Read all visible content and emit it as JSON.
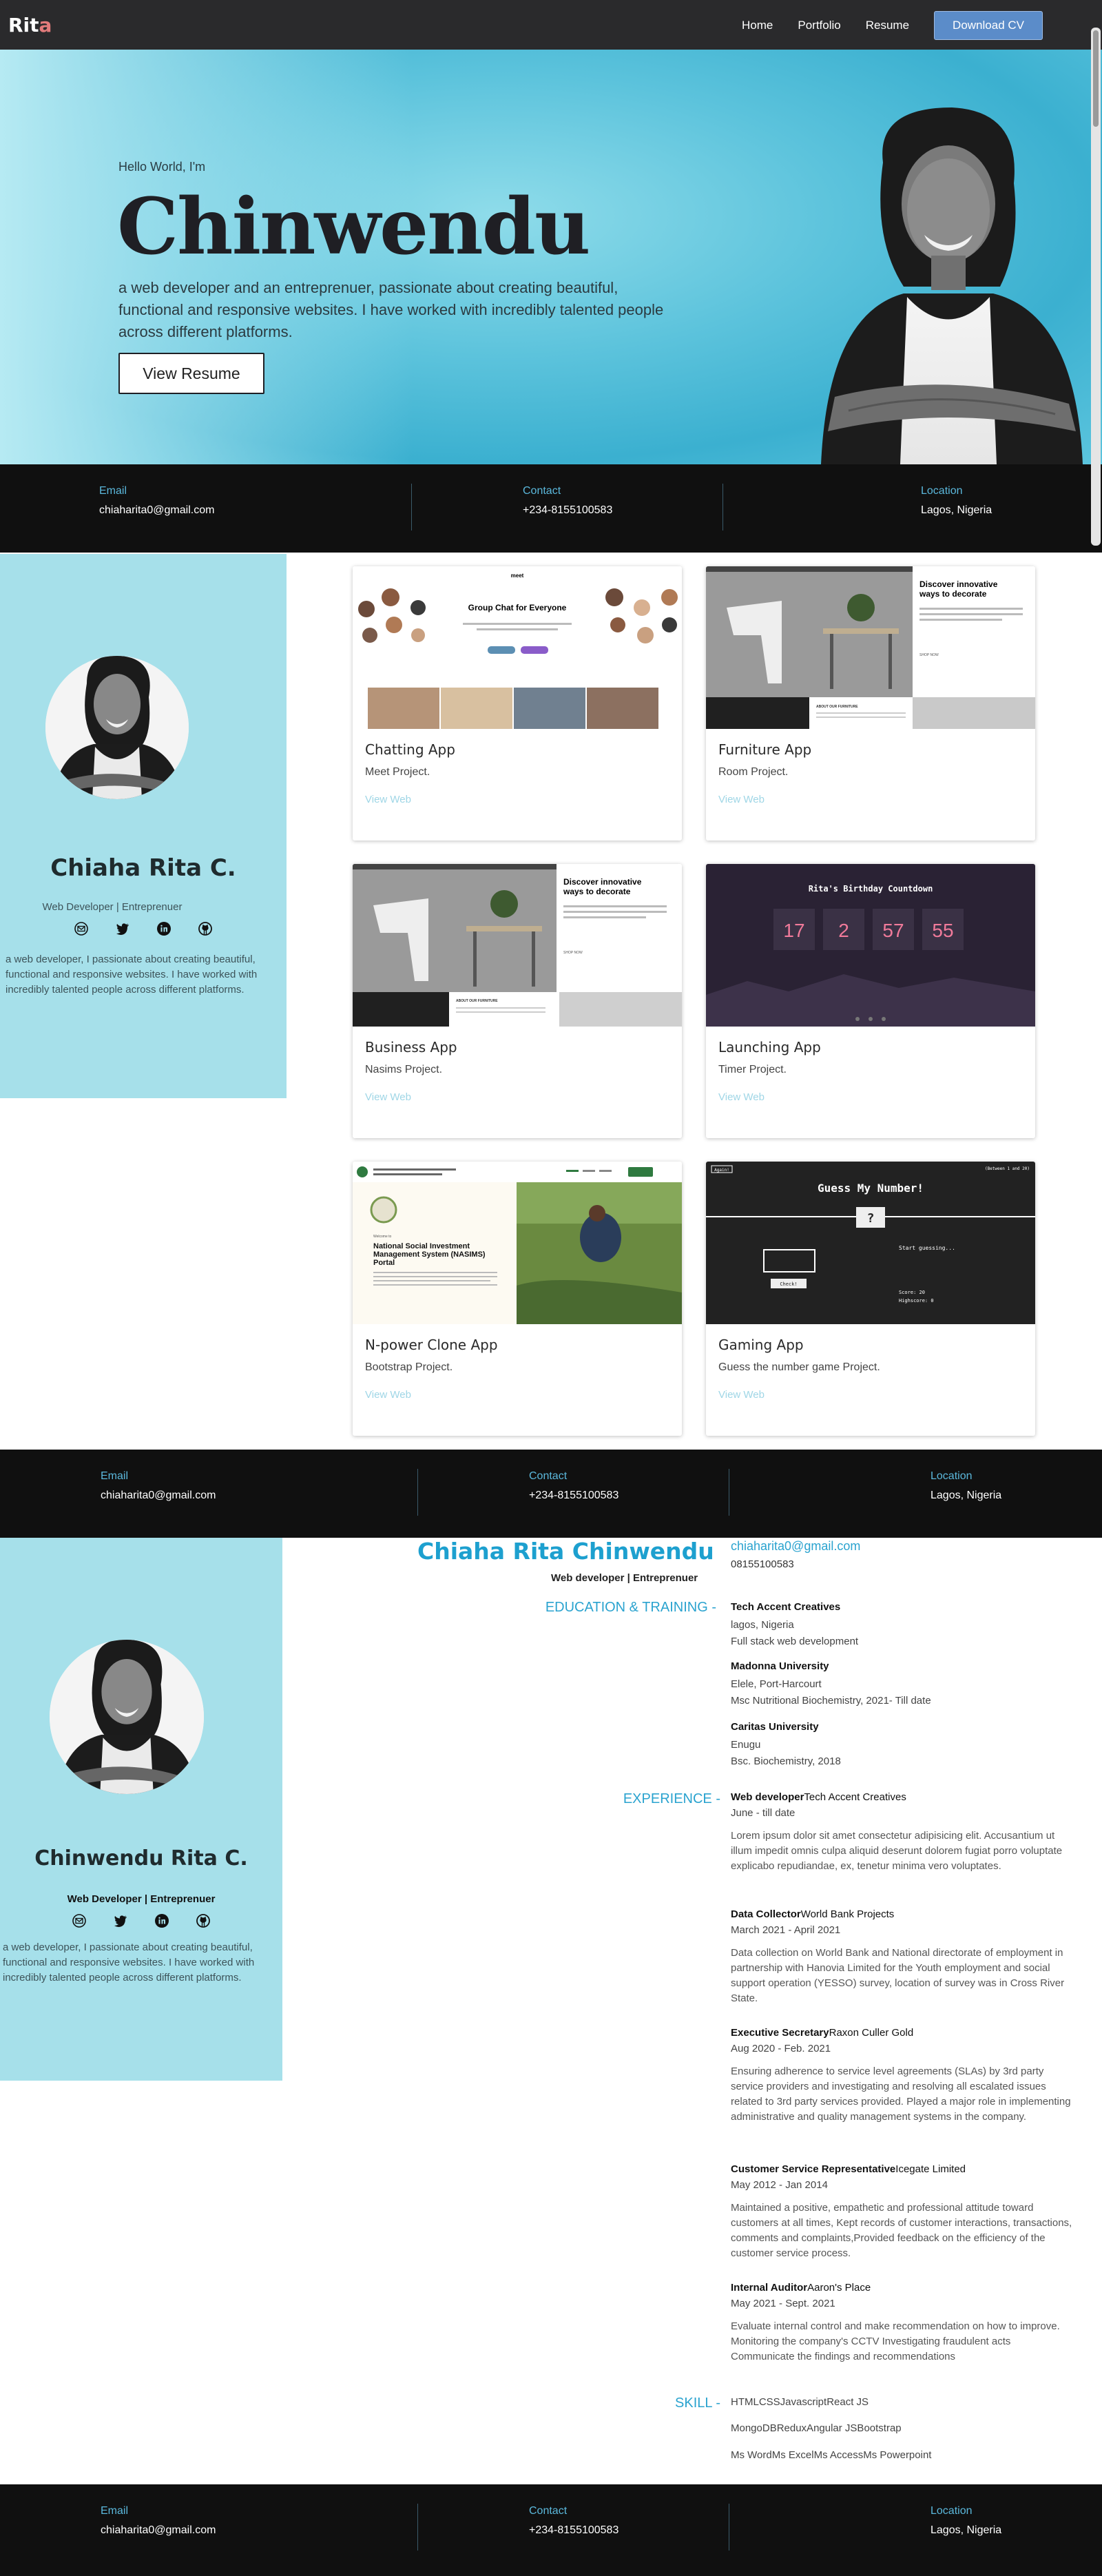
{
  "nav": {
    "logo_main": "Rit",
    "logo_accent": "a",
    "links": [
      "Home",
      "Portfolio",
      "Resume"
    ],
    "cta": "Download CV"
  },
  "hero": {
    "greeting": "Hello World, I'm",
    "name": "Chinwendu",
    "description": "a web developer and an entreprenuer, passionate about creating beautiful, functional and responsive websites. I have worked with incredibly talented people across different platforms.",
    "button": "View Resume"
  },
  "contact": {
    "email_label": "Email",
    "email": "chiaharita0@gmail.com",
    "contact_label": "Contact",
    "phone": "+234-8155100583",
    "location_label": "Location",
    "location": "Lagos, Nigeria"
  },
  "portfolio_profile": {
    "name": "Chiaha Rita C.",
    "role": "Web Developer | Entreprenuer",
    "description": "a web developer, I passionate about creating beautiful, functional and responsive websites. I have worked with incredibly talented people across different platforms."
  },
  "projects": [
    {
      "title": "Chatting App",
      "subtitle": "Meet Project.",
      "link": "View Web",
      "shot": {
        "brand": "meet",
        "headline": "Group Chat for Everyone"
      }
    },
    {
      "title": "Furniture App",
      "subtitle": "Room Project.",
      "link": "View Web",
      "shot": {
        "headline": "Discover innovative ways to decorate",
        "about": "ABOUT OUR FURNITURE",
        "shop": "SHOP NOW"
      }
    },
    {
      "title": "Business App",
      "subtitle": "Nasims Project.",
      "link": "View Web",
      "shot": {
        "headline": "Discover innovative ways to decorate",
        "about": "ABOUT OUR FURNITURE",
        "shop": "SHOP NOW"
      }
    },
    {
      "title": "Launching App",
      "subtitle": "Timer Project.",
      "link": "View Web",
      "shot": {
        "headline": "Rita's Birthday Countdown",
        "digits": [
          "17",
          "2",
          "57",
          "55"
        ]
      }
    },
    {
      "title": "N-power Clone App",
      "subtitle": "Bootstrap Project.",
      "link": "View Web",
      "shot": {
        "headline": "National Social Investment Management System (NASIMS) Portal",
        "label": "Welcome to"
      }
    },
    {
      "title": "Gaming App",
      "subtitle": "Guess the number game Project.",
      "link": "View Web",
      "shot": {
        "headline": "Guess My Number!",
        "again": "Again!",
        "range": "(Between 1 and 20)",
        "mark": "?",
        "start": "Start guessing...",
        "check": "Check!",
        "score": "Score: 20",
        "highscore": "Highscore: 0"
      }
    }
  ],
  "resume_profile": {
    "name": "Chinwendu Rita C.",
    "role": "Web Developer | Entreprenuer",
    "description": "a web developer, I passionate about creating beautiful, functional and responsive websites. I have worked with incredibly talented people across different platforms."
  },
  "resume": {
    "name": "Chiaha Rita Chinwendu",
    "role": "Web developer | Entreprenuer",
    "email": "chiaharita0@gmail.com",
    "phone": "08155100583",
    "education_heading": "EDUCATION & TRAINING -",
    "education": [
      {
        "org": "Tech Accent Creatives",
        "lines": [
          "lagos, Nigeria",
          "Full stack web development"
        ]
      },
      {
        "org": "Madonna University",
        "lines": [
          "Elele, Port-Harcourt",
          "Msc Nutritional Biochemistry, 2021- Till date"
        ]
      },
      {
        "org": "Caritas University",
        "lines": [
          "Enugu",
          "Bsc. Biochemistry, 2018"
        ]
      }
    ],
    "experience_heading": "EXPERIENCE -",
    "experience": [
      {
        "title": "Web developer",
        "company": "Tech Accent Creatives",
        "dates": "June - till date",
        "desc": "Lorem ipsum dolor sit amet consectetur adipisicing elit. Accusantium ut illum impedit omnis culpa aliquid deserunt dolorem fugiat porro voluptate explicabo repudiandae, ex, tenetur minima vero voluptates."
      },
      {
        "title": "Data Collector",
        "company": "World Bank Projects",
        "dates": "March 2021 - April 2021",
        "desc": "Data collection on World Bank and National directorate of employment in partnership with Hanovia Limited for the Youth employment and social support operation (YESSO) survey, location of survey was in Cross River State."
      },
      {
        "title": "Executive Secretary",
        "company": "Raxon Culler Gold",
        "dates": "Aug 2020 - Feb. 2021",
        "desc": "Ensuring adherence to service level agreements (SLAs) by 3rd party service providers and investigating and resolving all escalated issues related to 3rd party services provided. Played a major role in implementing administrative and quality management systems in the company."
      },
      {
        "title": "Customer Service Representative",
        "company": "Icegate Limited",
        "dates": "May 2012 - Jan 2014",
        "desc": "Maintained a positive, empathetic and professional attitude toward customers at all times, Kept records of customer interactions, transactions, comments and complaints,Provided feedback on the efficiency of the customer service process."
      },
      {
        "title": "Internal Auditor",
        "company": "Aaron's Place",
        "dates": "May 2021 - Sept. 2021",
        "desc": "Evaluate internal control and make recommendation on how to improve. Monitoring the company's CCTV Investigating fraudulent acts Communicate the findings and recommendations"
      }
    ],
    "skill_heading": "SKILL -",
    "skills": [
      "HTMLCSSJavascriptReact JS",
      "MongoDBReduxAngular JSBootstrap",
      "Ms WordMs ExcelMs AccessMs Powerpoint"
    ]
  },
  "colors": {
    "accent": "#2aa3cf",
    "panel": "#a6e0ea",
    "dark": "#101010",
    "nav": "#2a2a2c",
    "button": "#5b8cc9"
  },
  "icons": [
    "email-icon",
    "twitter-icon",
    "linkedin-icon",
    "github-icon"
  ]
}
